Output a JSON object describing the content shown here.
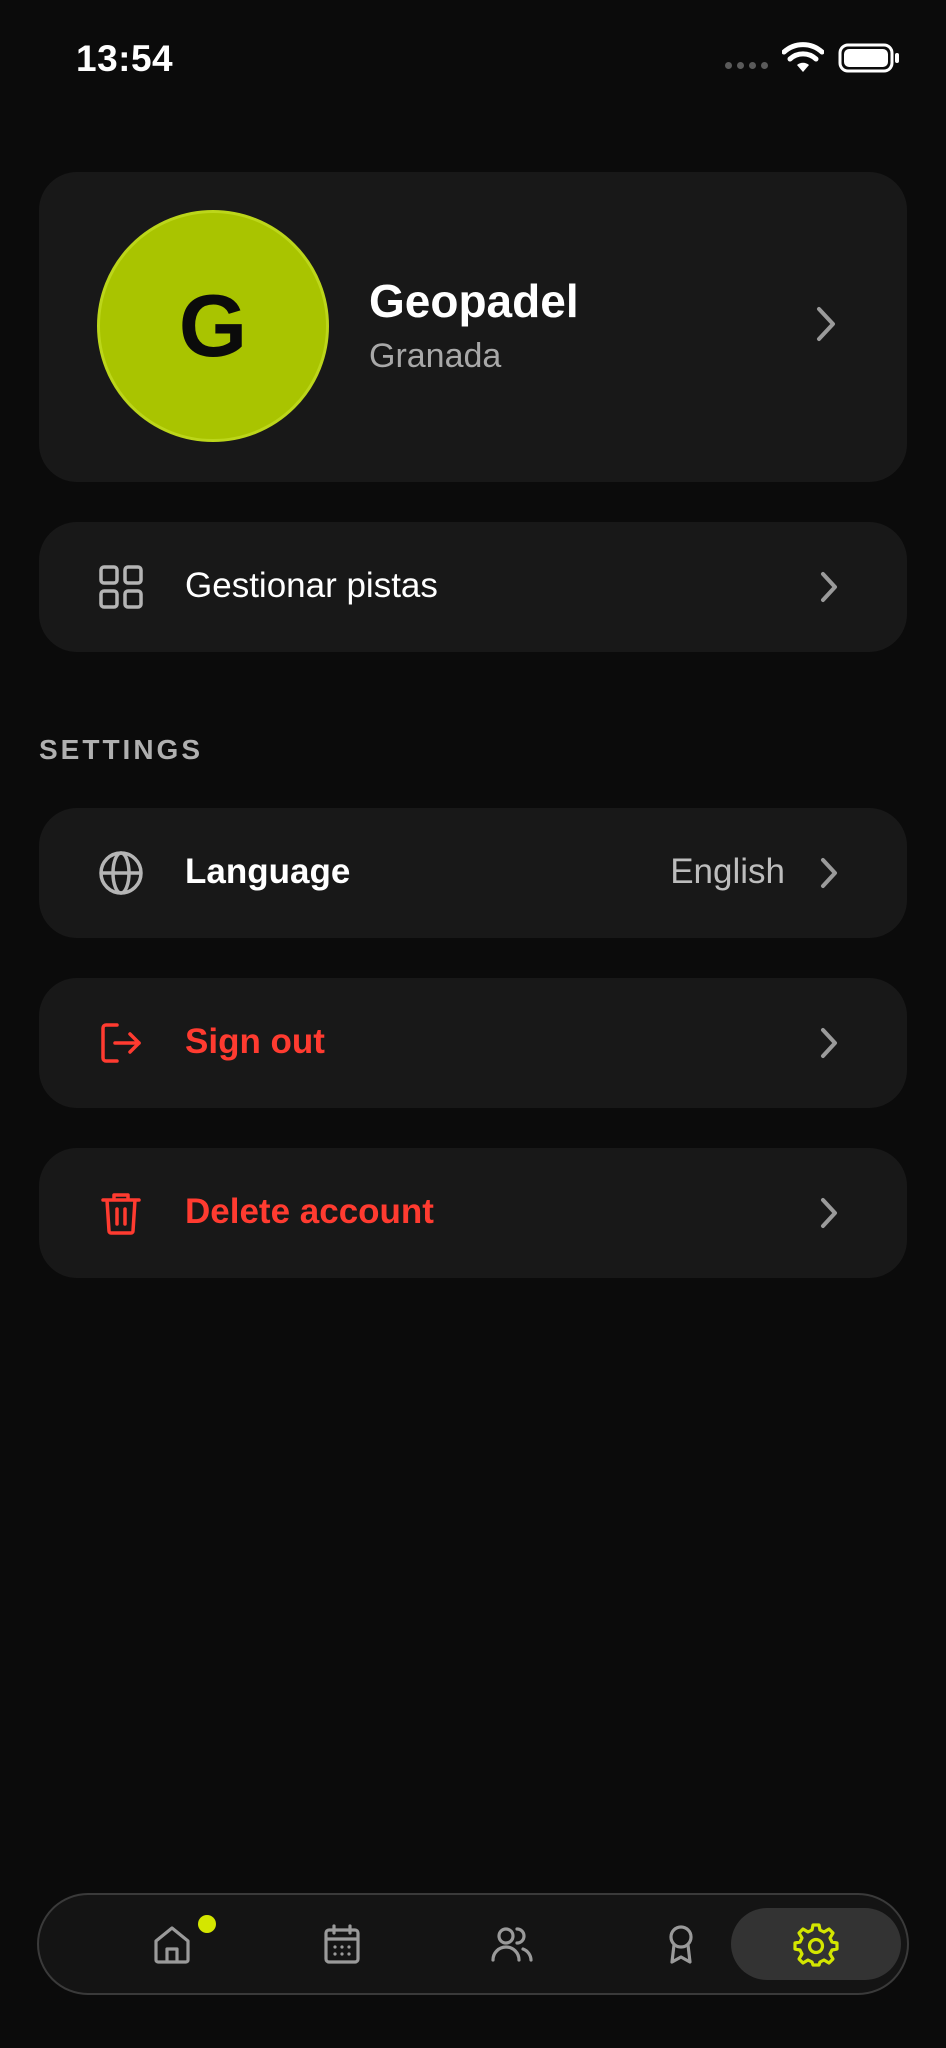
{
  "status_bar": {
    "time": "13:54"
  },
  "profile": {
    "initial": "G",
    "name": "Geopadel",
    "city": "Granada"
  },
  "manage": {
    "label": "Gestionar pistas"
  },
  "settings": {
    "header": "SETTINGS",
    "language_label": "Language",
    "language_value": "English",
    "sign_out_label": "Sign out",
    "delete_label": "Delete account"
  },
  "colors": {
    "accent": "#a9c400",
    "active_tab_icon": "#d4e600",
    "danger": "#ff3b30",
    "card": "#181818",
    "background": "#0b0b0b"
  },
  "tabs": [
    {
      "icon": "home-icon",
      "has_badge": true,
      "active": false
    },
    {
      "icon": "calendar-icon",
      "has_badge": false,
      "active": false
    },
    {
      "icon": "users-icon",
      "has_badge": false,
      "active": false
    },
    {
      "icon": "award-icon",
      "has_badge": false,
      "active": false
    },
    {
      "icon": "gear-icon",
      "has_badge": false,
      "active": true
    }
  ]
}
